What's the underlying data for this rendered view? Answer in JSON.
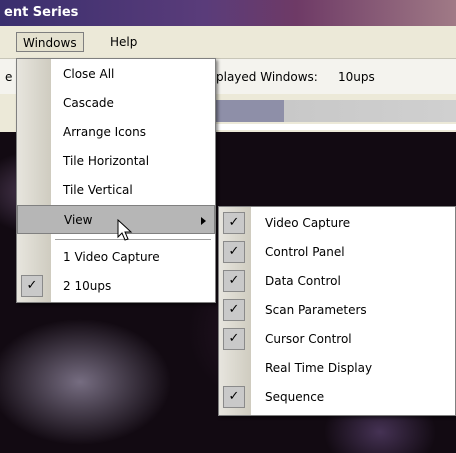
{
  "window": {
    "title": "ent Series"
  },
  "menubar": {
    "items": [
      {
        "label": "Windows"
      },
      {
        "label": "Help"
      }
    ]
  },
  "toolbar": {
    "left_stub": "e",
    "displayed_windows_label": "played Windows:",
    "displayed_windows_value": "10ups"
  },
  "windows_menu": {
    "items": [
      {
        "label": "Close All"
      },
      {
        "label": "Cascade"
      },
      {
        "label": "Arrange Icons"
      },
      {
        "label": "Tile Horizontal"
      },
      {
        "label": "Tile Vertical"
      },
      {
        "label": "View",
        "highlighted": true,
        "submenu": true
      }
    ],
    "window_list": [
      {
        "label": "1 Video Capture",
        "checked": false
      },
      {
        "label": "2 10ups",
        "checked": true
      }
    ]
  },
  "view_submenu": {
    "items": [
      {
        "label": "Video Capture",
        "checked": true
      },
      {
        "label": "Control Panel",
        "checked": true
      },
      {
        "label": "Data Control",
        "checked": true
      },
      {
        "label": "Scan Parameters",
        "checked": true
      },
      {
        "label": "Cursor Control",
        "checked": true
      },
      {
        "label": "Real Time Display",
        "checked": false
      },
      {
        "label": "Sequence",
        "checked": true
      }
    ]
  },
  "icons": {
    "check": "checkmark-icon",
    "submenu_arrow": "triangle-right-icon",
    "cursor": "mouse-pointer-icon"
  },
  "colors": {
    "menu_highlight": "#b6b6b6",
    "menu_background": "#ffffff",
    "check_box": "#c9c9c9"
  }
}
